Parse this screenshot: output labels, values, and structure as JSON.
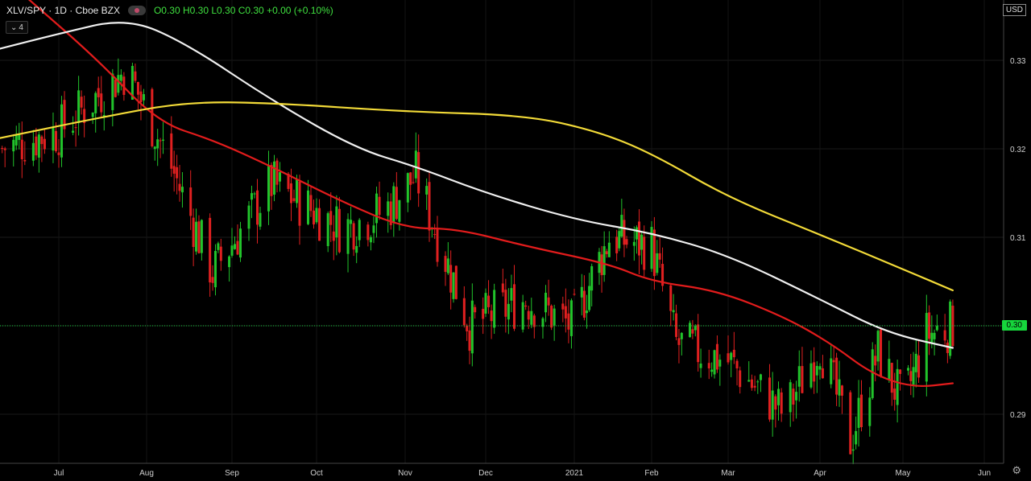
{
  "header": {
    "symbol": "XLV/SPY",
    "interval": "1D",
    "exchange": "Cboe BZX",
    "ohlc": "O0.30 H0.30 L0.30 C0.30 +0.00 (+0.10%)",
    "indicators_count": "4",
    "currency": "USD"
  },
  "last_price_label": "0.30",
  "colors": {
    "background": "#000000",
    "up": "#21c32b",
    "down": "#e02020",
    "ma_red": "#e21c1c",
    "ma_white": "#f0f0f0",
    "ma_yellow": "#f2da38",
    "price_tag": "#16d63c"
  },
  "chart_data": {
    "type": "candlestick",
    "y_axis": {
      "ticks": [
        0.29,
        0.3,
        0.31,
        0.32,
        0.33
      ],
      "tick_labels": [
        "0.29",
        "0.31",
        "0.32",
        "0.33"
      ],
      "range": [
        0.284,
        0.336
      ]
    },
    "x_axis": {
      "labels": [
        "Jul",
        "Aug",
        "Sep",
        "Oct",
        "Nov",
        "Dec",
        "2021",
        "Feb",
        "Mar",
        "Apr",
        "May",
        "Jun"
      ]
    },
    "last_price": 0.3,
    "approx_close_path": [
      {
        "date": "Jun 10",
        "value": 0.32
      },
      {
        "date": "Jul 1",
        "value": 0.322
      },
      {
        "date": "Jul 25",
        "value": 0.329
      },
      {
        "date": "Aug 10",
        "value": 0.318
      },
      {
        "date": "Aug 25",
        "value": 0.306
      },
      {
        "date": "Sep 15",
        "value": 0.316
      },
      {
        "date": "Oct 10",
        "value": 0.311
      },
      {
        "date": "Oct 25",
        "value": 0.313
      },
      {
        "date": "Nov 5",
        "value": 0.317
      },
      {
        "date": "Nov 25",
        "value": 0.3
      },
      {
        "date": "Dec 15",
        "value": 0.303
      },
      {
        "date": "Dec 31",
        "value": 0.3
      },
      {
        "date": "Jan 15",
        "value": 0.31
      },
      {
        "date": "Feb 1",
        "value": 0.309
      },
      {
        "date": "Feb 10",
        "value": 0.298
      },
      {
        "date": "Mar 1",
        "value": 0.296
      },
      {
        "date": "Mar 20",
        "value": 0.29
      },
      {
        "date": "Apr 1",
        "value": 0.298
      },
      {
        "date": "Apr 12",
        "value": 0.287
      },
      {
        "date": "Apr 22",
        "value": 0.297
      },
      {
        "date": "May 1",
        "value": 0.291
      },
      {
        "date": "May 10",
        "value": 0.299
      },
      {
        "date": "May 20",
        "value": 0.3
      }
    ],
    "series": [
      {
        "color": "red",
        "values": [
          {
            "date": "Jun 20",
            "value": 0.337
          },
          {
            "date": "Jul 15",
            "value": 0.33
          },
          {
            "date": "Aug 5",
            "value": 0.323
          },
          {
            "date": "Aug 25",
            "value": 0.321
          },
          {
            "date": "Sep 15",
            "value": 0.318
          },
          {
            "date": "Oct 10",
            "value": 0.314
          },
          {
            "date": "Nov 1",
            "value": 0.311
          },
          {
            "date": "Nov 20",
            "value": 0.311
          },
          {
            "date": "Dec 15",
            "value": 0.309
          },
          {
            "date": "Jan 15",
            "value": 0.307
          },
          {
            "date": "Feb 1",
            "value": 0.305
          },
          {
            "date": "Feb 25",
            "value": 0.304
          },
          {
            "date": "Mar 20",
            "value": 0.301
          },
          {
            "date": "Apr 5",
            "value": 0.298
          },
          {
            "date": "Apr 20",
            "value": 0.2945
          },
          {
            "date": "May 5",
            "value": 0.293
          },
          {
            "date": "May 20",
            "value": 0.2935
          }
        ]
      },
      {
        "color": "white",
        "values": [
          {
            "date": "Jun 10",
            "value": 0.3313
          },
          {
            "date": "Jul 1",
            "value": 0.333
          },
          {
            "date": "Jul 25",
            "value": 0.3348
          },
          {
            "date": "Aug 15",
            "value": 0.332
          },
          {
            "date": "Sep 15",
            "value": 0.3255
          },
          {
            "date": "Oct 15",
            "value": 0.32
          },
          {
            "date": "Nov 5",
            "value": 0.318
          },
          {
            "date": "Dec 1",
            "value": 0.315
          },
          {
            "date": "Jan 1",
            "value": 0.312
          },
          {
            "date": "Feb 1",
            "value": 0.3105
          },
          {
            "date": "Mar 1",
            "value": 0.308
          },
          {
            "date": "Apr 1",
            "value": 0.303
          },
          {
            "date": "Apr 25",
            "value": 0.2992
          },
          {
            "date": "May 20",
            "value": 0.2975
          }
        ]
      },
      {
        "color": "yellow",
        "values": [
          {
            "date": "Jun 10",
            "value": 0.3212
          },
          {
            "date": "Jul 15",
            "value": 0.3235
          },
          {
            "date": "Aug 15",
            "value": 0.3253
          },
          {
            "date": "Sep 15",
            "value": 0.3252
          },
          {
            "date": "Nov 1",
            "value": 0.3242
          },
          {
            "date": "Dec 15",
            "value": 0.3238
          },
          {
            "date": "Jan 10",
            "value": 0.322
          },
          {
            "date": "Feb 1",
            "value": 0.3195
          },
          {
            "date": "Mar 1",
            "value": 0.3145
          },
          {
            "date": "Apr 1",
            "value": 0.3103
          },
          {
            "date": "May 1",
            "value": 0.3064
          },
          {
            "date": "May 20",
            "value": 0.304
          }
        ]
      }
    ]
  }
}
